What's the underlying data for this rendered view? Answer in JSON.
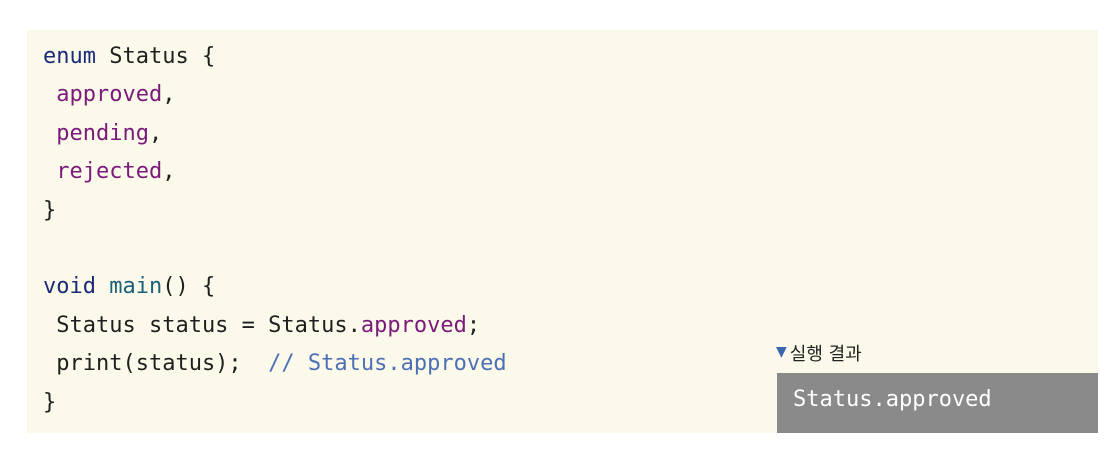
{
  "code": {
    "lines": [
      [
        {
          "t": "enum",
          "c": "kw"
        },
        {
          "t": " Status {",
          "c": ""
        }
      ],
      [
        {
          "t": " ",
          "c": ""
        },
        {
          "t": "approved",
          "c": "enum-val"
        },
        {
          "t": ",",
          "c": ""
        }
      ],
      [
        {
          "t": " ",
          "c": ""
        },
        {
          "t": "pending",
          "c": "enum-val"
        },
        {
          "t": ",",
          "c": ""
        }
      ],
      [
        {
          "t": " ",
          "c": ""
        },
        {
          "t": "rejected",
          "c": "enum-val"
        },
        {
          "t": ",",
          "c": ""
        }
      ],
      [
        {
          "t": "}",
          "c": ""
        }
      ],
      [],
      [
        {
          "t": "void",
          "c": "kw"
        },
        {
          "t": " ",
          "c": ""
        },
        {
          "t": "main",
          "c": "fn"
        },
        {
          "t": "() {",
          "c": ""
        }
      ],
      [
        {
          "t": " Status status = Status.",
          "c": ""
        },
        {
          "t": "approved",
          "c": "enum-val"
        },
        {
          "t": ";",
          "c": ""
        }
      ],
      [
        {
          "t": " print(status);  ",
          "c": ""
        },
        {
          "t": "// Status.approved",
          "c": "cmt"
        }
      ],
      [
        {
          "t": "}",
          "c": ""
        }
      ]
    ]
  },
  "result": {
    "label": "실행 결과",
    "icon": "triangle-down-icon",
    "output": "Status.approved"
  },
  "colors": {
    "background": "#fbf9e9",
    "keyword": "#1c2a7a",
    "function": "#1b5f7a",
    "enum_value": "#7a1a7a",
    "comment": "#4d6fb5",
    "result_box": "#8a8a8a",
    "triangle": "#3a63b0"
  }
}
